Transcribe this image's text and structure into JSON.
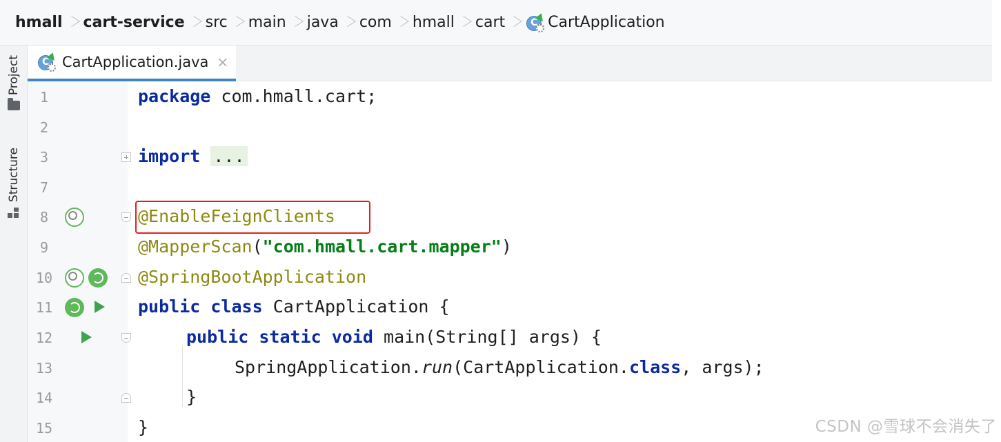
{
  "breadcrumb": {
    "items": [
      {
        "label": "hmall",
        "bold": true
      },
      {
        "label": "cart-service",
        "bold": true
      },
      {
        "label": "src"
      },
      {
        "label": "main"
      },
      {
        "label": "java"
      },
      {
        "label": "com"
      },
      {
        "label": "hmall"
      },
      {
        "label": "cart"
      },
      {
        "label": "CartApplication",
        "icon": "spring-class-icon"
      }
    ]
  },
  "toolstrip": {
    "project_label": "Project",
    "structure_label": "Structure"
  },
  "tab": {
    "filename": "CartApplication.java",
    "close_glyph": "×",
    "icon": "spring-class-icon"
  },
  "editor": {
    "lines": [
      {
        "num": "1",
        "code": "package com.hmall.cart;"
      },
      {
        "num": "2",
        "code": ""
      },
      {
        "num": "3",
        "code": "import ..."
      },
      {
        "num": "7",
        "code": ""
      },
      {
        "num": "8",
        "code": "@EnableFeignClients",
        "gutter_icons": [
          "spring-bean-icon"
        ]
      },
      {
        "num": "9",
        "code": "@MapperScan(\"com.hmall.cart.mapper\")"
      },
      {
        "num": "10",
        "code": "@SpringBootApplication",
        "gutter_icons": [
          "spring-bean-icon",
          "spring-config-icon"
        ]
      },
      {
        "num": "11",
        "code": "public class CartApplication {",
        "gutter_icons": [
          "spring-class-icon",
          "run-icon"
        ]
      },
      {
        "num": "12",
        "code": "public static void main(String[] args) {",
        "gutter_icons": [
          "run-icon"
        ]
      },
      {
        "num": "13",
        "code": "SpringApplication.run(CartApplication.class, args);"
      },
      {
        "num": "14",
        "code": "}"
      },
      {
        "num": "15",
        "code": "}"
      }
    ],
    "highlight_line": "8"
  },
  "tokens": {
    "package_kw": "package",
    "package_name": " com.hmall.cart;",
    "import_kw": "import",
    "import_fold": "...",
    "ann_feign": "@EnableFeignClients",
    "ann_mapper": "@MapperScan",
    "mapper_open": "(",
    "mapper_str": "\"com.hmall.cart.mapper\"",
    "mapper_close": ")",
    "ann_boot": "@SpringBootApplication",
    "public_kw": "public",
    "class_kw": "class",
    "class_rest": " CartApplication {",
    "static_kw": "static",
    "void_kw": "void",
    "main_rest": " main(String[] args) {",
    "run_pre": "SpringApplication.",
    "run_method": "run",
    "run_mid": "(CartApplication.",
    "run_class_kw": "class",
    "run_end": ", args);",
    "brace_close": "}"
  },
  "watermark": "CSDN @雪球不会消失了",
  "colors": {
    "keyword": "#0a2aa0",
    "annotation": "#8c8a10",
    "string": "#067d17",
    "highlight_border": "#e02020",
    "tab_underline": "#4083c9"
  }
}
